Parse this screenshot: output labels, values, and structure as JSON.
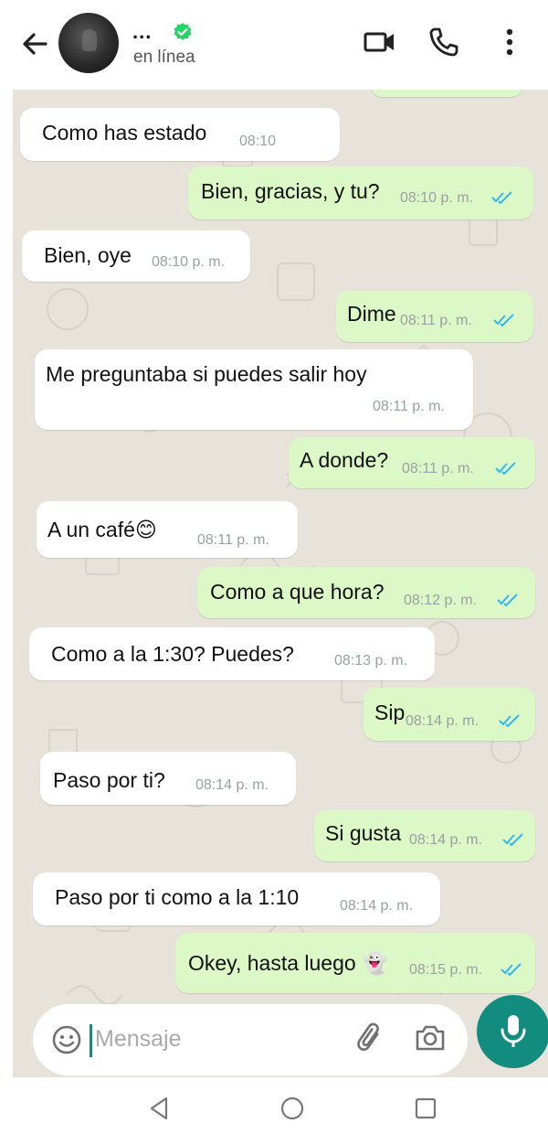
{
  "header": {
    "contact_name": "...",
    "status": "en línea"
  },
  "messages": [
    {
      "dir": "in",
      "text": "Como has estado",
      "time": "08:10"
    },
    {
      "dir": "out",
      "text": "Bien, gracias, y tu?",
      "time": "08:10 p. m."
    },
    {
      "dir": "in",
      "text": "Bien, oye",
      "time": "08:10 p. m."
    },
    {
      "dir": "out",
      "text": "Dime",
      "time": "08:11 p. m."
    },
    {
      "dir": "in",
      "text": "Me preguntaba si puedes salir hoy",
      "time": "08:11 p. m."
    },
    {
      "dir": "out",
      "text": "A donde?",
      "time": "08:11 p. m."
    },
    {
      "dir": "in",
      "text": "A un café😊",
      "time": "08:11 p. m."
    },
    {
      "dir": "out",
      "text": "Como a que hora?",
      "time": "08:12 p. m."
    },
    {
      "dir": "in",
      "text": "Como a la 1:30? Puedes?",
      "time": "08:13 p. m."
    },
    {
      "dir": "out",
      "text": "Sip",
      "time": "08:14 p. m."
    },
    {
      "dir": "in",
      "text": "Paso por ti?",
      "time": "08:14 p. m."
    },
    {
      "dir": "out",
      "text": "Si gusta",
      "time": "08:14 p. m."
    },
    {
      "dir": "in",
      "text": "Paso por ti como a la 1:10",
      "time": "08:14 p. m."
    },
    {
      "dir": "out",
      "text": "Okey, hasta luego 👻",
      "time": "08:15 p. m."
    }
  ],
  "composer": {
    "placeholder": "Mensaje"
  },
  "icons": {
    "header": [
      "back-arrow-icon",
      "verified-badge-icon",
      "video-call-icon",
      "phone-call-icon",
      "more-options-icon"
    ],
    "composer": [
      "emoji-icon",
      "attach-icon",
      "camera-icon",
      "mic-icon"
    ],
    "read_receipt": "double-check-icon",
    "nav": [
      "nav-back-icon",
      "nav-home-icon",
      "nav-recents-icon"
    ]
  },
  "colors": {
    "chat_background": "#e7e2da",
    "incoming_bubble": "#ffffff",
    "outgoing_bubble": "#dcf8c6",
    "accent": "#128c7e",
    "read_tick": "#34b7f1",
    "verified": "#25d366"
  }
}
